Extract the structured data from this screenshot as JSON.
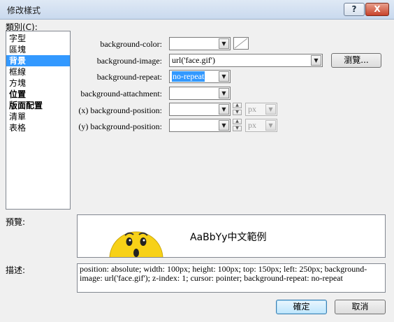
{
  "window": {
    "title": "修改樣式",
    "help_label": "?",
    "close_label": "X"
  },
  "category": {
    "label": "類別(C):",
    "items": [
      {
        "label": "字型",
        "selected": false,
        "bold": false
      },
      {
        "label": "區塊",
        "selected": false,
        "bold": false
      },
      {
        "label": "背景",
        "selected": true,
        "bold": true
      },
      {
        "label": "框線",
        "selected": false,
        "bold": false
      },
      {
        "label": "方塊",
        "selected": false,
        "bold": false
      },
      {
        "label": "位置",
        "selected": false,
        "bold": true
      },
      {
        "label": "版面配置",
        "selected": false,
        "bold": true
      },
      {
        "label": "清單",
        "selected": false,
        "bold": false
      },
      {
        "label": "表格",
        "selected": false,
        "bold": false
      }
    ]
  },
  "properties": {
    "background_color": {
      "label": "background-color:",
      "value": ""
    },
    "background_image": {
      "label": "background-image:",
      "value": "url('face.gif')",
      "browse_label": "瀏覽..."
    },
    "background_repeat": {
      "label": "background-repeat:",
      "value": "no-repeat"
    },
    "background_attachment": {
      "label": "background-attachment:",
      "value": ""
    },
    "x_position": {
      "label": "(x) background-position:",
      "value": "",
      "unit": "px"
    },
    "y_position": {
      "label": "(y) background-position:",
      "value": "",
      "unit": "px"
    }
  },
  "preview": {
    "label": "預覽:",
    "sample_text": "AaBbYy中文範例"
  },
  "description": {
    "label": "描述:",
    "text": "position: absolute; width: 100px; height: 100px; top: 150px; left: 250px; background-image: url('face.gif'); z-index: 1; cursor: pointer; background-repeat: no-repeat"
  },
  "buttons": {
    "ok": "確定",
    "cancel": "取消"
  },
  "colors": {
    "selection": "#3399ff",
    "face": "#f7d117"
  }
}
